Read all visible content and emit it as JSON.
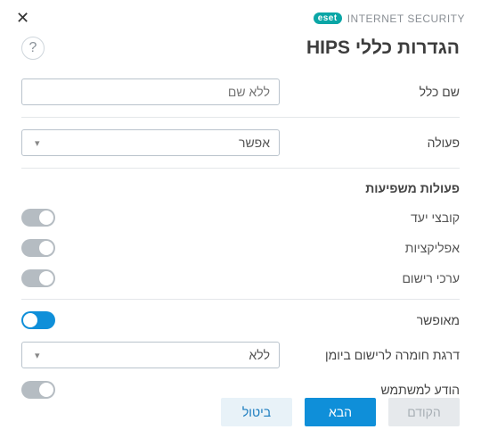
{
  "brand": {
    "badge": "eset",
    "product": "INTERNET SECURITY"
  },
  "title": "הגדרות כללי HIPS",
  "labels": {
    "rule_name": "שם כלל",
    "action": "פעולה",
    "affecting_ops": "פעולות משפיעות",
    "target_files": "קובצי יעד",
    "applications": "אפליקציות",
    "registry_values": "ערכי רישום",
    "enabled": "מאופשר",
    "log_severity": "דרגת חומרה לרישום ביומן",
    "notify_user": "הודע למשתמש"
  },
  "values": {
    "rule_name_placeholder": "ללא שם",
    "action_selected": "אפשר",
    "log_severity_selected": "ללא",
    "target_files_on": false,
    "applications_on": false,
    "registry_values_on": false,
    "enabled_on": true,
    "notify_user_on": false
  },
  "buttons": {
    "prev": "הקודם",
    "next": "הבא",
    "cancel": "ביטול"
  }
}
